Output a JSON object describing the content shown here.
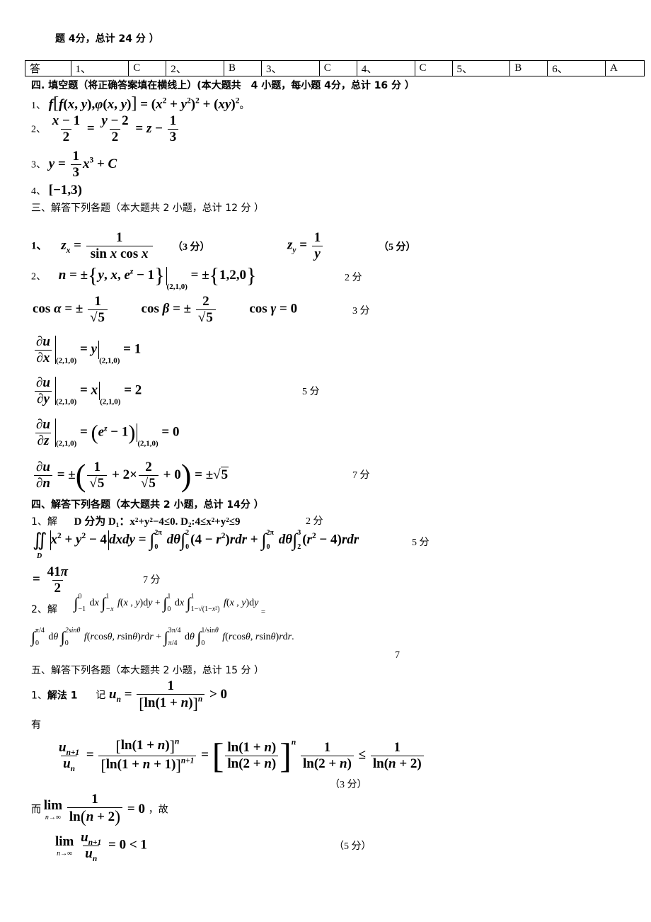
{
  "header_fragment": "题 4分，总计 24 分 ）",
  "answer_table": {
    "label": "答",
    "cells": [
      {
        "num": "1、",
        "ans": "C"
      },
      {
        "num": "2、",
        "ans": "B"
      },
      {
        "num": "3、",
        "ans": "C"
      },
      {
        "num": "4、",
        "ans": "C"
      },
      {
        "num": "5、",
        "ans": "B"
      },
      {
        "num": "6、",
        "ans": "A"
      }
    ]
  },
  "section_fill": {
    "title": "四. 填空题（将正确答案填在横线上）(本大题共　4 小题，每小题 4分，总计 16 分 ）",
    "items": [
      {
        "num": "1、",
        "answer": "f[f(x,y),φ(x,y)] = (x² + y²)² + (xy)²。"
      },
      {
        "num": "2、",
        "answer": "(x−1)/2 = (y−2)/2 = z − 1/3"
      },
      {
        "num": "3、",
        "answer": "y = (1/3)x³ + C"
      },
      {
        "num": "4、",
        "answer": "[−1,3)"
      }
    ]
  },
  "section_3": {
    "title": "三、解答下列各题（本大题共 2 小题，总计 12 分 ）",
    "q1": {
      "num": "1、",
      "zx": "z_x = 1/(sin x cos x)",
      "zx_score": "（3 分）",
      "zy": "z_y = 1/y",
      "zy_score": "（5 分）"
    },
    "q2": {
      "num": "2、",
      "normal": "n = ±{y, x, e^z − 1}|(2,1,0) = ±{1,2,0}",
      "normal_score": "2 分",
      "cos": "cos α = ±1/√5　cos β = ±2/√5　cos γ = 0",
      "cos_score": "3 分",
      "du_dx": "∂u/∂x|(2,1,0) = y|(2,1,0) = 1",
      "du_dy": "∂u/∂y|(2,1,0) = x|(2,1,0) = 2",
      "du_dy_score": "5 分",
      "du_dz": "∂u/∂z|(2,1,0) = (e^z − 1)|(2,1,0) = 0",
      "du_dn": "∂u/∂n = ±(1/√5 + 2×2/√5 + 0) = ±√5",
      "du_dn_score": "7 分",
      "point": "(2,1,0)"
    }
  },
  "section_4": {
    "title": "四、解答下列各题（本大题共 2 小题，总计 14分 ）",
    "q1": {
      "num": "1、解",
      "domain_text": "D 分为 D₁：x²+y²−4≤0. D₂:4≤x²+y²≤9",
      "domain_score": "2 分",
      "integral": "∬_D |x² + y² − 4| dxdy = ∫₀^{2π} dθ ∫₀² (4 − r²) r dr + ∫₀^{2π} dθ ∫₂³ (r² − 4) r dr",
      "integral_score": "5 分",
      "result": "= 41π/2",
      "result_score": "7 分"
    },
    "q2": {
      "num": "2、解",
      "line1": "∫₋₁⁰ dx ∫₋ₓ¹ f(x,y)dy + ∫₀¹ dx ∫_{1−√(1−x²)}¹ f(x,y)dy =",
      "line2": "∫₀^{π/4} dθ ∫₀^{2sinθ} f(rcosθ, rsinθ) r dr + ∫_{π/4}^{3π/4} dθ ∫₀^{1/sinθ} f(rcosθ, rsinθ) r dr.",
      "score": "7"
    }
  },
  "section_5": {
    "title": "五、解答下列各题（本大题共 2 小题，总计 15 分 ）",
    "q1": {
      "num": "1、",
      "method": "解法 1",
      "define": "记 u_n = 1/[ln(1+n)]^n > 0",
      "have": "有",
      "ratio": "u_{n+1}/u_n = [ln(1+n)]^n / [ln(1+n+1)]^{n+1} = [ln(1+n)/ln(2+n)]^n · 1/ln(2+n) ≤ 1/ln(n+2)",
      "ratio_score": "（3 分）",
      "limit_prefix": "而",
      "limit": "lim_{n→∞} 1/ln(n+2) = 0",
      "limit_suffix": "，故",
      "final": "lim_{n→∞} u_{n+1}/u_n = 0 < 1",
      "final_score": "（5 分）"
    }
  }
}
